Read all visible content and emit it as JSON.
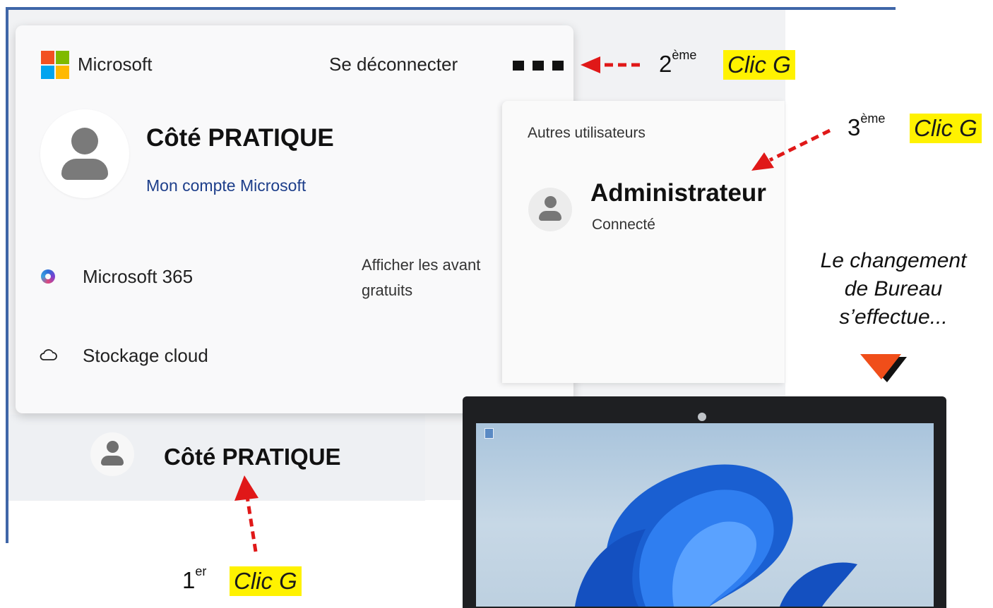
{
  "account_flyout": {
    "brand": "Microsoft",
    "sign_out": "Se déconnecter",
    "profile_name": "Côté PRATIQUE",
    "account_link": "Mon compte Microsoft",
    "m365_label": "Microsoft 365",
    "benefits_line1": "Afficher les avant",
    "benefits_line2": "gratuits",
    "cloud_label": "Stockage cloud"
  },
  "other_users": {
    "title": "Autres utilisateurs",
    "admin_name": "Administrateur",
    "admin_status": "Connecté"
  },
  "taskbar": {
    "user_name": "Côté PRATIQUE"
  },
  "annotations": {
    "step1_num": "1",
    "step1_sup": "er",
    "step2_num": "2",
    "step2_sup": "ème",
    "step3_num": "3",
    "step3_sup": "ème",
    "clic_label": "Clic G",
    "note_line1": "Le changement",
    "note_line2": "de Bureau",
    "note_line3": "s’effectue..."
  },
  "colors": {
    "frame": "#3f66a8",
    "arrow": "#e01818",
    "highlight": "#fff200",
    "link": "#1d3e8a",
    "ms_red": "#f25022",
    "ms_green": "#7fba00",
    "ms_blue": "#00a4ef",
    "ms_yellow": "#ffb900"
  }
}
